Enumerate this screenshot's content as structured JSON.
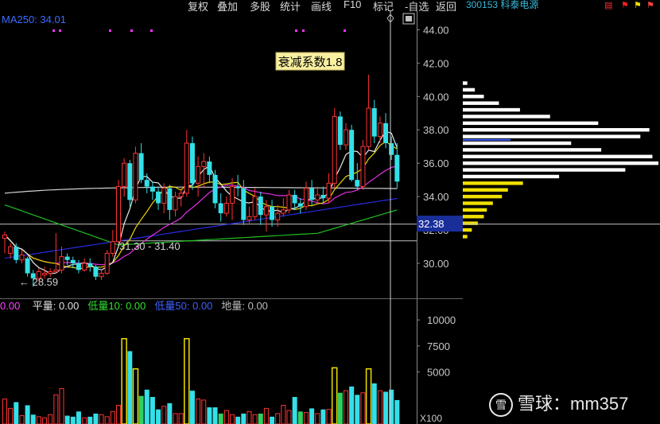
{
  "menu": {
    "items": [
      "复权",
      "叠加",
      "多股",
      "统计",
      "画线",
      "F10",
      "标记",
      "-自选",
      "返回"
    ],
    "stock_title": "300153 科泰电源"
  },
  "main_panel": {
    "ma_label": "MA250: 34.01",
    "annotation": "衰减系数1.8",
    "range_label": "31.30 - 31.40",
    "low_label": "← 28.59",
    "current_price": "32.38"
  },
  "volume_panel": {
    "legend": [
      {
        "text": "0.00",
        "color": "#ff40ff"
      },
      {
        "text": "平量: 0.00",
        "color": "#e0e0e0"
      },
      {
        "text": "低量10: 0.00",
        "color": "#30e030"
      },
      {
        "text": "低量50: 0.00",
        "color": "#4060ff"
      },
      {
        "text": "地量: 0.00",
        "color": "#bbbbbb"
      }
    ],
    "unit_label": "X100"
  },
  "watermark": {
    "logo": "雪",
    "text": "雪球：mm357"
  },
  "chart_data": [
    {
      "type": "candlestick",
      "title": "300153 科泰电源",
      "ylim": [
        28.5,
        44.8
      ],
      "y_ticks": [
        "44.00",
        "42.00",
        "40.00",
        "38.00",
        "36.00",
        "34.00",
        "32.00",
        "30.00"
      ],
      "grid": false,
      "candles": [
        [
          31.5,
          31.7,
          31.9,
          30.6
        ],
        [
          30.6,
          31.0,
          31.2,
          30.3
        ],
        [
          31.0,
          30.2,
          31.2,
          30.0
        ],
        [
          30.2,
          30.5,
          30.8,
          30.0
        ],
        [
          30.3,
          29.4,
          30.4,
          29.2
        ],
        [
          29.4,
          29.1,
          29.6,
          28.6
        ],
        [
          29.1,
          29.5,
          29.7,
          28.9
        ],
        [
          29.3,
          29.4,
          29.8,
          29.1
        ],
        [
          29.4,
          29.5,
          29.7,
          29.2
        ],
        [
          29.5,
          29.6,
          31.8,
          29.4
        ],
        [
          29.6,
          30.4,
          31.0,
          29.4
        ],
        [
          30.4,
          30.2,
          30.6,
          29.9
        ],
        [
          30.2,
          30.0,
          30.4,
          29.7
        ],
        [
          30.0,
          29.6,
          30.2,
          29.4
        ],
        [
          29.6,
          30.0,
          30.3,
          29.5
        ],
        [
          30.0,
          29.8,
          30.3,
          29.5
        ],
        [
          29.8,
          29.2,
          29.9,
          29.0
        ],
        [
          29.2,
          29.4,
          29.6,
          29.0
        ],
        [
          29.4,
          30.6,
          30.8,
          29.3
        ],
        [
          30.6,
          31.3,
          32.0,
          30.4
        ],
        [
          31.3,
          34.6,
          35.0,
          31.2
        ],
        [
          34.6,
          36.0,
          36.3,
          34.0
        ],
        [
          36.0,
          33.8,
          36.2,
          33.4
        ],
        [
          33.8,
          36.6,
          37.0,
          33.6
        ],
        [
          36.6,
          35.0,
          37.2,
          34.8
        ],
        [
          35.0,
          34.6,
          35.4,
          34.2
        ],
        [
          34.6,
          34.3,
          34.9,
          33.8
        ],
        [
          34.3,
          33.6,
          34.6,
          33.2
        ],
        [
          33.6,
          34.5,
          34.8,
          33.0
        ],
        [
          34.5,
          33.2,
          34.7,
          32.6
        ],
        [
          33.2,
          34.0,
          34.3,
          32.8
        ],
        [
          34.0,
          34.2,
          34.5,
          33.4
        ],
        [
          34.2,
          37.2,
          38.0,
          34.0
        ],
        [
          37.2,
          34.8,
          37.6,
          34.4
        ],
        [
          34.8,
          35.8,
          36.4,
          34.0
        ],
        [
          35.8,
          36.1,
          36.6,
          34.5
        ],
        [
          36.1,
          35.3,
          36.4,
          34.8
        ],
        [
          35.3,
          33.6,
          35.6,
          33.3
        ],
        [
          33.6,
          33.0,
          34.2,
          32.5
        ],
        [
          33.0,
          33.6,
          34.0,
          32.8
        ],
        [
          33.6,
          34.6,
          35.1,
          32.6
        ],
        [
          34.6,
          34.5,
          35.3,
          34.0
        ],
        [
          34.5,
          32.6,
          35.0,
          32.3
        ],
        [
          32.6,
          32.8,
          33.4,
          32.4
        ],
        [
          32.8,
          34.0,
          34.5,
          32.6
        ],
        [
          34.0,
          32.9,
          34.3,
          32.3
        ],
        [
          32.9,
          33.4,
          33.8,
          31.9
        ],
        [
          33.4,
          32.6,
          33.8,
          32.2
        ],
        [
          32.6,
          33.0,
          33.5,
          32.2
        ],
        [
          33.0,
          33.2,
          33.9,
          32.8
        ],
        [
          33.2,
          34.1,
          34.4,
          33.0
        ],
        [
          34.1,
          33.6,
          34.4,
          33.2
        ],
        [
          33.6,
          33.4,
          33.9,
          33.0
        ],
        [
          33.4,
          34.5,
          34.9,
          33.2
        ],
        [
          34.5,
          33.8,
          35.0,
          33.5
        ],
        [
          33.8,
          34.1,
          34.6,
          33.5
        ],
        [
          34.1,
          33.9,
          34.6,
          33.6
        ],
        [
          33.9,
          34.8,
          35.4,
          33.6
        ],
        [
          34.8,
          38.8,
          39.3,
          34.5
        ],
        [
          38.8,
          37.1,
          39.1,
          36.8
        ],
        [
          37.1,
          38.0,
          38.4,
          36.8
        ],
        [
          38.0,
          35.0,
          38.3,
          34.9
        ],
        [
          35.0,
          34.6,
          36.0,
          34.4
        ],
        [
          34.6,
          37.0,
          37.4,
          34.4
        ],
        [
          37.0,
          39.3,
          41.3,
          36.8
        ],
        [
          39.3,
          37.6,
          39.8,
          37.2
        ],
        [
          37.6,
          38.4,
          38.8,
          37.2
        ],
        [
          38.4,
          37.2,
          39.0,
          36.9
        ],
        [
          37.2,
          36.5,
          37.6,
          36.2
        ],
        [
          36.5,
          34.9,
          37.2,
          34.5
        ]
      ],
      "series": [
        {
          "name": "MA250",
          "color": "#2a2ae0"
        },
        {
          "color": "#e8e8e8"
        },
        {
          "color": "#e8d800"
        },
        {
          "color": "#e030e0"
        },
        {
          "color": "#20c020"
        },
        {
          "color": "#d0d0d0"
        }
      ],
      "volume_profile": {
        "levels": [
          40.8,
          40.4,
          40.0,
          39.6,
          39.2,
          38.8,
          38.4,
          38.0,
          37.6,
          37.2,
          36.8,
          36.4,
          36.0,
          35.6,
          35.2,
          34.8,
          34.4,
          34.0,
          33.6,
          33.2,
          32.8,
          32.4,
          32.0,
          31.6
        ],
        "values": [
          3,
          8,
          14,
          24,
          38,
          58,
          90,
          124,
          118,
          72,
          92,
          126,
          130,
          108,
          64,
          40,
          30,
          26,
          20,
          16,
          14,
          10,
          6,
          3
        ]
      }
    },
    {
      "type": "bar",
      "title": "",
      "ylim": [
        0,
        12000
      ],
      "y_ticks": [
        "10000",
        "7500",
        "5000"
      ],
      "volumes": [
        2400,
        1500,
        2100,
        800,
        1800,
        900,
        700,
        600,
        900,
        2800,
        3400,
        800,
        700,
        1200,
        600,
        700,
        1000,
        900,
        700,
        1200,
        1800,
        8200,
        7000,
        5300,
        2700,
        3300,
        2600,
        1400,
        1700,
        2000,
        1000,
        1000,
        8200,
        3200,
        2400,
        2300,
        1600,
        1600,
        1000,
        1300,
        900,
        700,
        1000,
        1200,
        900,
        1000,
        1500,
        700,
        1000,
        1800,
        1300,
        2600,
        1200,
        1100,
        1500,
        1000,
        1400,
        1400,
        5400,
        3000,
        3200,
        3600,
        2800,
        3000,
        5300,
        3900,
        3200,
        3100,
        3300,
        2300
      ]
    }
  ]
}
